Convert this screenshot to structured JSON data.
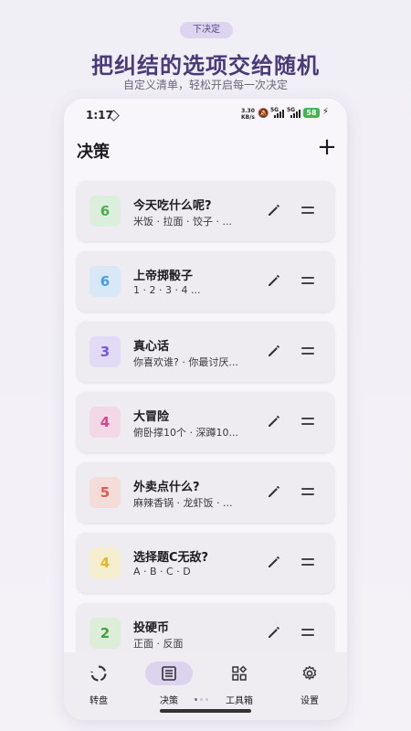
{
  "promo": {
    "tag": "下决定",
    "title": "把纠结的选项交给随机",
    "subtitle": "自定义清单，轻松开启每一次决定"
  },
  "status_bar": {
    "time": "1:17",
    "speed": "3.30",
    "speed_unit": "KB/s",
    "net1": "5G",
    "net2": "5G",
    "battery": "58"
  },
  "app": {
    "title": "决策",
    "add_label": "+"
  },
  "items": [
    {
      "count": "6",
      "title": "今天吃什么呢?",
      "subtitle": "米饭 · 拉面 · 饺子 · ...",
      "color": "#4caf50",
      "bg": "#dcefdc"
    },
    {
      "count": "6",
      "title": "上帝掷骰子",
      "subtitle": "1 · 2 · 3 · 4 ...",
      "color": "#4a9be0",
      "bg": "#d8e8f7"
    },
    {
      "count": "3",
      "title": "真心话",
      "subtitle": "你喜欢谁? · 你最讨厌...",
      "color": "#7a55d6",
      "bg": "#e3dbf5"
    },
    {
      "count": "4",
      "title": "大冒险",
      "subtitle": "俯卧撑10个 · 深蹲10...",
      "color": "#d9468e",
      "bg": "#f3d9e7"
    },
    {
      "count": "5",
      "title": "外卖点什么?",
      "subtitle": "麻辣香锅 · 龙虾饭 · ...",
      "color": "#e05a4e",
      "bg": "#f4dcd9"
    },
    {
      "count": "4",
      "title": "选择题C无敌?",
      "subtitle": "A · B · C · D",
      "color": "#e6b72c",
      "bg": "#f6efcf"
    },
    {
      "count": "2",
      "title": "投硬币",
      "subtitle": "正面 · 反面",
      "color": "#43a047",
      "bg": "#dcedd8"
    }
  ],
  "nav": [
    {
      "label": "转盘",
      "icon": "spinner-icon",
      "active": false
    },
    {
      "label": "决策",
      "icon": "list-icon",
      "active": true
    },
    {
      "label": "工具箱",
      "icon": "toolbox-icon",
      "active": false
    },
    {
      "label": "设置",
      "icon": "gear-icon",
      "active": false
    }
  ],
  "colors": {
    "accent": "#4a3b78",
    "nav_active_pill": "#dcd3ef",
    "battery": "#3fb551"
  }
}
